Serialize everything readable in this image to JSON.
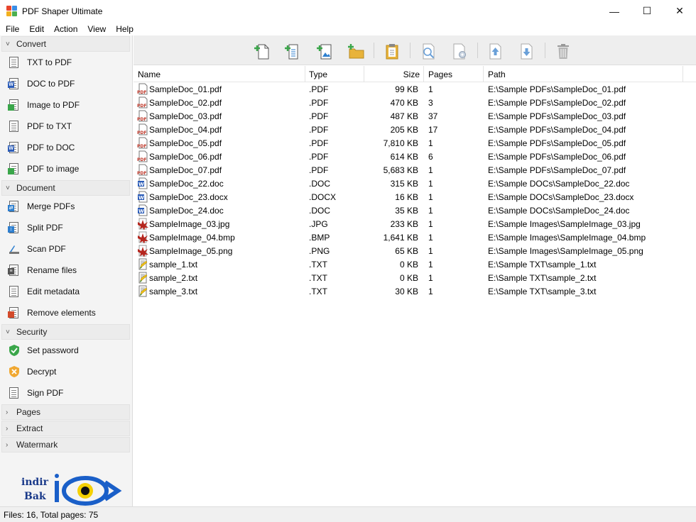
{
  "window": {
    "title": "PDF Shaper Ultimate"
  },
  "menu": [
    "File",
    "Edit",
    "Action",
    "View",
    "Help"
  ],
  "sidebar": {
    "sections": [
      {
        "label": "Convert",
        "expanded": true,
        "items": [
          {
            "label": "TXT to PDF",
            "icon": "txt-doc-icon"
          },
          {
            "label": "DOC to PDF",
            "icon": "word-doc-icon"
          },
          {
            "label": "Image to PDF",
            "icon": "image-doc-icon"
          },
          {
            "label": "PDF to TXT",
            "icon": "pdf-txt-icon"
          },
          {
            "label": "PDF to DOC",
            "icon": "pdf-word-icon"
          },
          {
            "label": "PDF to image",
            "icon": "pdf-image-icon"
          }
        ]
      },
      {
        "label": "Document",
        "expanded": true,
        "items": [
          {
            "label": "Merge PDFs",
            "icon": "merge-icon"
          },
          {
            "label": "Split PDF",
            "icon": "split-icon"
          },
          {
            "label": "Scan PDF",
            "icon": "scanner-icon"
          },
          {
            "label": "Rename files",
            "icon": "rename-icon"
          },
          {
            "label": "Edit metadata",
            "icon": "metadata-icon"
          },
          {
            "label": "Remove elements",
            "icon": "remove-elements-icon"
          }
        ]
      },
      {
        "label": "Security",
        "expanded": true,
        "items": [
          {
            "label": "Set password",
            "icon": "shield-check-icon"
          },
          {
            "label": "Decrypt",
            "icon": "shield-x-icon"
          },
          {
            "label": "Sign PDF",
            "icon": "sign-doc-icon"
          }
        ]
      },
      {
        "label": "Pages",
        "expanded": false,
        "items": []
      },
      {
        "label": "Extract",
        "expanded": false,
        "items": []
      },
      {
        "label": "Watermark",
        "expanded": false,
        "items": []
      }
    ],
    "logo": {
      "line1": "indir",
      "line2": "Bak"
    }
  },
  "toolbar": [
    "add-file-icon",
    "add-list-icon",
    "add-image-icon",
    "add-folder-icon",
    "paste-icon",
    "preview-icon",
    "settings-doc-icon",
    "move-up-icon",
    "move-down-icon",
    "trash-icon"
  ],
  "columns": {
    "name": "Name",
    "type": "Type",
    "size": "Size",
    "pages": "Pages",
    "path": "Path"
  },
  "files": [
    {
      "name": "SampleDoc_01.pdf",
      "type": ".PDF",
      "size": "99 KB",
      "pages": "1",
      "path": "E:\\Sample PDFs\\SampleDoc_01.pdf",
      "kind": "pdf"
    },
    {
      "name": "SampleDoc_02.pdf",
      "type": ".PDF",
      "size": "470 KB",
      "pages": "3",
      "path": "E:\\Sample PDFs\\SampleDoc_02.pdf",
      "kind": "pdf"
    },
    {
      "name": "SampleDoc_03.pdf",
      "type": ".PDF",
      "size": "487 KB",
      "pages": "37",
      "path": "E:\\Sample PDFs\\SampleDoc_03.pdf",
      "kind": "pdf"
    },
    {
      "name": "SampleDoc_04.pdf",
      "type": ".PDF",
      "size": "205 KB",
      "pages": "17",
      "path": "E:\\Sample PDFs\\SampleDoc_04.pdf",
      "kind": "pdf"
    },
    {
      "name": "SampleDoc_05.pdf",
      "type": ".PDF",
      "size": "7,810 KB",
      "pages": "1",
      "path": "E:\\Sample PDFs\\SampleDoc_05.pdf",
      "kind": "pdf"
    },
    {
      "name": "SampleDoc_06.pdf",
      "type": ".PDF",
      "size": "614 KB",
      "pages": "6",
      "path": "E:\\Sample PDFs\\SampleDoc_06.pdf",
      "kind": "pdf"
    },
    {
      "name": "SampleDoc_07.pdf",
      "type": ".PDF",
      "size": "5,683 KB",
      "pages": "1",
      "path": "E:\\Sample PDFs\\SampleDoc_07.pdf",
      "kind": "pdf"
    },
    {
      "name": "SampleDoc_22.doc",
      "type": ".DOC",
      "size": "315 KB",
      "pages": "1",
      "path": "E:\\Sample DOCs\\SampleDoc_22.doc",
      "kind": "doc"
    },
    {
      "name": "SampleDoc_23.docx",
      "type": ".DOCX",
      "size": "16 KB",
      "pages": "1",
      "path": "E:\\Sample DOCs\\SampleDoc_23.docx",
      "kind": "doc"
    },
    {
      "name": "SampleDoc_24.doc",
      "type": ".DOC",
      "size": "35 KB",
      "pages": "1",
      "path": "E:\\Sample DOCs\\SampleDoc_24.doc",
      "kind": "doc"
    },
    {
      "name": "SampleImage_03.jpg",
      "type": ".JPG",
      "size": "233 KB",
      "pages": "1",
      "path": "E:\\Sample Images\\SampleImage_03.jpg",
      "kind": "img"
    },
    {
      "name": "SampleImage_04.bmp",
      "type": ".BMP",
      "size": "1,641 KB",
      "pages": "1",
      "path": "E:\\Sample Images\\SampleImage_04.bmp",
      "kind": "img"
    },
    {
      "name": "SampleImage_05.png",
      "type": ".PNG",
      "size": "65 KB",
      "pages": "1",
      "path": "E:\\Sample Images\\SampleImage_05.png",
      "kind": "img"
    },
    {
      "name": "sample_1.txt",
      "type": ".TXT",
      "size": "0 KB",
      "pages": "1",
      "path": "E:\\Sample TXT\\sample_1.txt",
      "kind": "txt"
    },
    {
      "name": "sample_2.txt",
      "type": ".TXT",
      "size": "0 KB",
      "pages": "1",
      "path": "E:\\Sample TXT\\sample_2.txt",
      "kind": "txt"
    },
    {
      "name": "sample_3.txt",
      "type": ".TXT",
      "size": "30 KB",
      "pages": "1",
      "path": "E:\\Sample TXT\\sample_3.txt",
      "kind": "txt"
    }
  ],
  "status": {
    "text": "Files: 16, Total pages: 75"
  }
}
